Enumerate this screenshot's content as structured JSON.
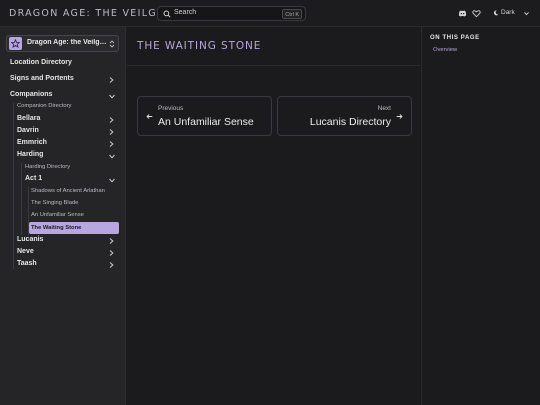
{
  "header": {
    "site_title": "DRAGON AGE: THE VEILGUARD",
    "search_placeholder": "Search",
    "search_shortcut": "Ctrl K",
    "theme_label": "Dark"
  },
  "sidebar": {
    "wiki_name": "Dragon Age: the Veilguard",
    "items": [
      {
        "label": "Location Directory"
      },
      {
        "label": "Signs and Portents"
      },
      {
        "label": "Companions"
      },
      {
        "label": "Companion Directory"
      },
      {
        "label": "Bellara"
      },
      {
        "label": "Davrin"
      },
      {
        "label": "Emmrich"
      },
      {
        "label": "Harding"
      },
      {
        "label": "Harding Directory"
      },
      {
        "label": "Act 1"
      },
      {
        "label": "Shadows of Ancient Arlathan"
      },
      {
        "label": "The Singing Blade"
      },
      {
        "label": "An Unfamiliar Sense"
      },
      {
        "label": "The Waiting Stone"
      },
      {
        "label": "Lucanis"
      },
      {
        "label": "Neve"
      },
      {
        "label": "Taash"
      }
    ]
  },
  "main": {
    "title": "THE WAITING STONE",
    "prev": {
      "label": "Previous",
      "title": "An Unfamiliar Sense"
    },
    "next": {
      "label": "Next",
      "title": "Lucanis Directory"
    }
  },
  "toc": {
    "heading": "ON THIS PAGE",
    "items": [
      "Overview"
    ]
  },
  "colors": {
    "accent": "#b7a6e0",
    "background": "#1b1b1d",
    "sidebar": "#252527"
  }
}
